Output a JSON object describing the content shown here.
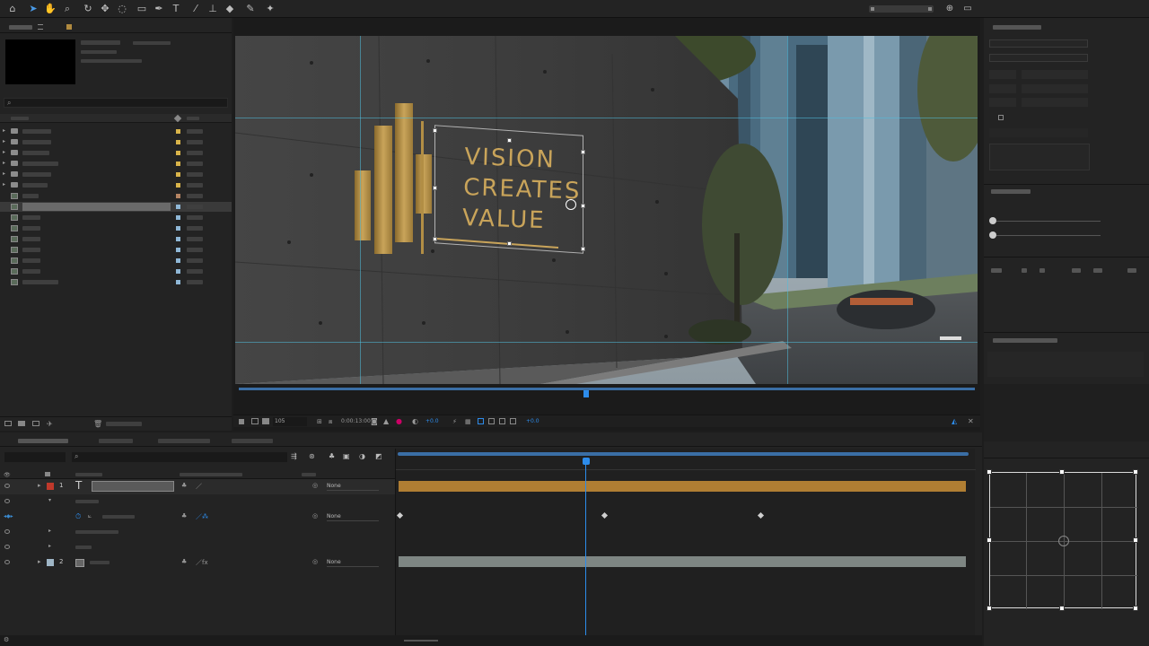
{
  "viewer": {
    "sign_line1": "VISION",
    "sign_line2": "CREATES",
    "sign_line3": "VALUE",
    "zoom": "105",
    "timecode": "0:00:13:00",
    "exposure": "+0.0",
    "exposure2": "+0.0"
  },
  "timeline": {
    "layer1_number": "1",
    "layer2_number": "2",
    "layer1_parent": "None",
    "layer2_parent": "None",
    "keyframe_parent": "None"
  },
  "colors": {
    "accent_blue": "#2d8ceb",
    "text_layer_bar": "#b07e33",
    "footage_bar": "#7e8683",
    "sign_gold": "#c9a45a"
  },
  "icons": [
    "home-icon",
    "selection-tool-icon",
    "hand-tool-icon",
    "zoom-tool-icon",
    "camera-rotate-icon",
    "pan-behind-icon",
    "rectangle-tool-icon",
    "pen-tool-icon",
    "type-tool-icon",
    "brush-tool-icon",
    "clone-stamp-icon",
    "eraser-icon",
    "roto-brush-icon",
    "puppet-pin-icon"
  ]
}
